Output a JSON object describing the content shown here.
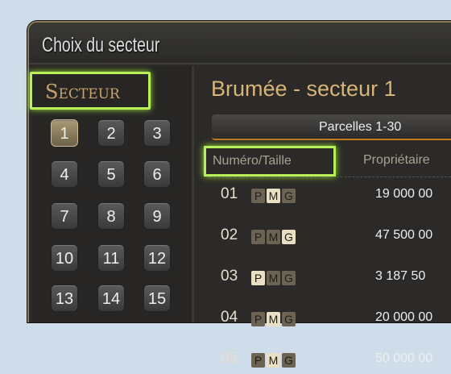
{
  "window": {
    "title": "Choix du secteur"
  },
  "sidebar": {
    "label": "Secteur",
    "buttons": [
      "1",
      "2",
      "3",
      "4",
      "5",
      "6",
      "7",
      "8",
      "9",
      "10",
      "11",
      "12",
      "13",
      "14",
      "15"
    ],
    "selected": "1"
  },
  "main": {
    "heading": "Brumée - secteur 1",
    "tab": "Parcelles 1-30",
    "columns": [
      "Numéro/Taille",
      "Propriétaire"
    ],
    "sizes": [
      "P",
      "M",
      "G"
    ],
    "rows": [
      {
        "num": "01",
        "size": "M",
        "price": "19 000 00"
      },
      {
        "num": "02",
        "size": "G",
        "price": "47 500 00"
      },
      {
        "num": "03",
        "size": "P",
        "price": "3 187 50"
      },
      {
        "num": "04",
        "size": "M",
        "price": "20 000 00"
      },
      {
        "num": "05",
        "size": "M",
        "price": "50 000 00"
      }
    ]
  },
  "colors": {
    "highlight": "#b8f05a",
    "gold": "#d7b478"
  }
}
